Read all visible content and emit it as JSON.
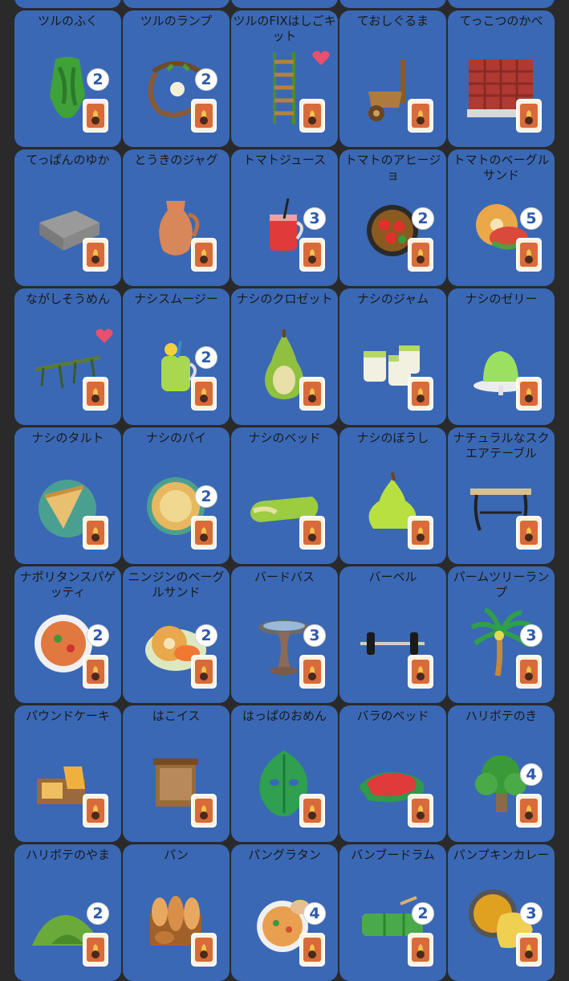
{
  "palette": {
    "tile": "#3a68b4",
    "background": "#2a2a2a",
    "badge_text": "#2f5aa8",
    "heart": "#e8506e",
    "card": "#d96a3a"
  },
  "items": [
    {
      "name": "",
      "icon": "item-icon"
    },
    {
      "name": "",
      "icon": "item-icon"
    },
    {
      "name": "",
      "icon": "item-icon"
    },
    {
      "name": "",
      "icon": "item-icon"
    },
    {
      "name": "",
      "icon": "item-icon"
    },
    {
      "name": "ツルのふく",
      "count": "2",
      "icon": "vine-outfit-icon"
    },
    {
      "name": "ツルのランプ",
      "count": "2",
      "icon": "vine-lamp-icon"
    },
    {
      "name": "ツルのFIXはしごキット",
      "favorite": true,
      "icon": "vine-ladder-icon"
    },
    {
      "name": "ておしぐるま",
      "icon": "wheelbarrow-icon"
    },
    {
      "name": "てっこつのかべ",
      "icon": "steel-frame-wall-icon"
    },
    {
      "name": "てっぱんのゆか",
      "icon": "steel-flooring-icon"
    },
    {
      "name": "とうきのジャグ",
      "icon": "ceramic-jug-icon"
    },
    {
      "name": "トマトジュース",
      "count": "3",
      "icon": "tomato-juice-icon"
    },
    {
      "name": "トマトのアヒージョ",
      "count": "2",
      "icon": "tomato-ajillo-icon"
    },
    {
      "name": "トマトのベーグルサンド",
      "count": "5",
      "icon": "tomato-bagel-icon"
    },
    {
      "name": "ながしそうめん",
      "favorite": true,
      "icon": "flowing-noodles-icon"
    },
    {
      "name": "ナシスムージー",
      "count": "2",
      "icon": "pear-smoothie-icon"
    },
    {
      "name": "ナシのクロゼット",
      "icon": "pear-wardrobe-icon"
    },
    {
      "name": "ナシのジャム",
      "icon": "pear-jam-icon"
    },
    {
      "name": "ナシのゼリー",
      "icon": "pear-jelly-icon"
    },
    {
      "name": "ナシのタルト",
      "icon": "pear-tart-icon"
    },
    {
      "name": "ナシのパイ",
      "count": "2",
      "icon": "pear-pie-icon"
    },
    {
      "name": "ナシのベッド",
      "icon": "pear-bed-icon"
    },
    {
      "name": "ナシのぼうし",
      "icon": "pear-hat-icon"
    },
    {
      "name": "ナチュラルなスクエアテーブル",
      "icon": "square-table-icon"
    },
    {
      "name": "ナポリタンスパゲッティ",
      "count": "2",
      "icon": "napolitan-icon"
    },
    {
      "name": "ニンジンのベーグルサンド",
      "count": "2",
      "icon": "carrot-bagel-icon"
    },
    {
      "name": "バードバス",
      "count": "3",
      "icon": "birdbath-icon"
    },
    {
      "name": "バーベル",
      "icon": "barbell-icon"
    },
    {
      "name": "パームツリーランプ",
      "count": "3",
      "icon": "palm-tree-lamp-icon"
    },
    {
      "name": "パウンドケーキ",
      "icon": "pound-cake-icon"
    },
    {
      "name": "はこイス",
      "icon": "box-stool-icon"
    },
    {
      "name": "はっぱのおめん",
      "icon": "leaf-mask-icon"
    },
    {
      "name": "バラのベッド",
      "icon": "rose-bed-icon"
    },
    {
      "name": "ハリボテのき",
      "count": "4",
      "icon": "cardboard-tree-icon"
    },
    {
      "name": "ハリボテのやま",
      "count": "2",
      "icon": "cardboard-mountain-icon"
    },
    {
      "name": "パン",
      "icon": "bread-icon"
    },
    {
      "name": "パングラタン",
      "count": "4",
      "icon": "bread-gratin-icon"
    },
    {
      "name": "バンブードラム",
      "count": "2",
      "icon": "bamboo-drum-icon"
    },
    {
      "name": "パンプキンカレー",
      "count": "3",
      "icon": "pumpkin-curry-icon"
    }
  ]
}
